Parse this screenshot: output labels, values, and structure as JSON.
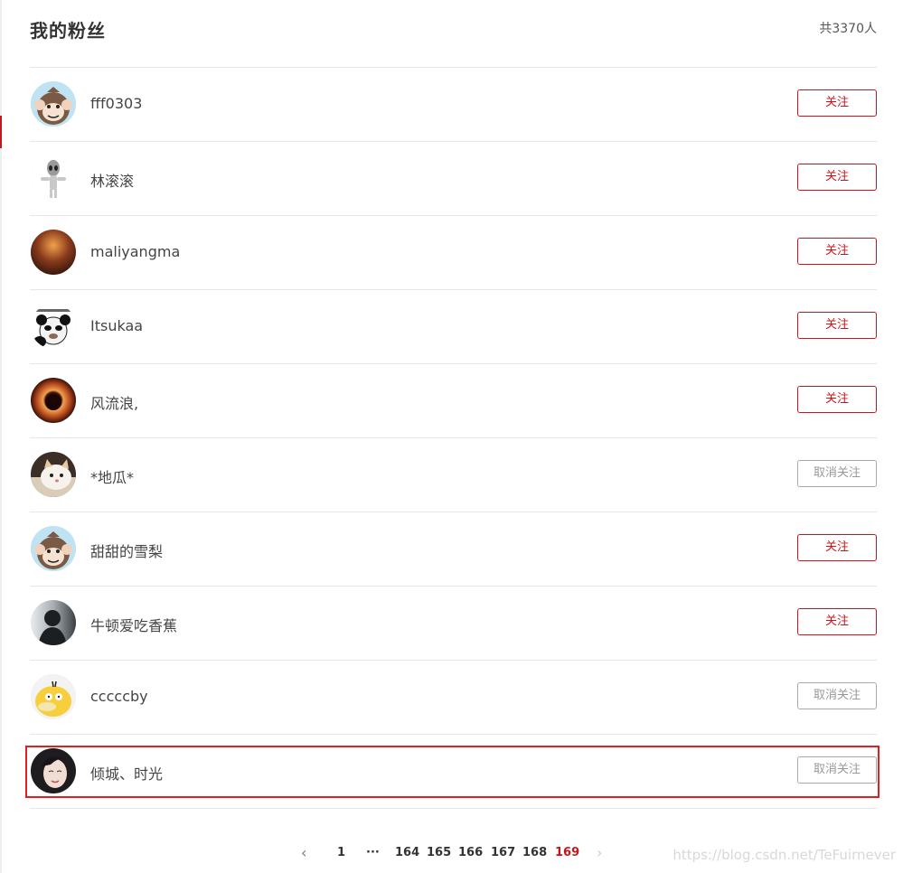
{
  "header": {
    "title": "我的粉丝",
    "total": "共3370人"
  },
  "fans": [
    {
      "name": "fff0303",
      "button": "关注",
      "state": "follow",
      "avatar": "monkey-avatar"
    },
    {
      "name": "林滚滚",
      "button": "关注",
      "state": "follow",
      "avatar": "alien-avatar"
    },
    {
      "name": "maliyangma",
      "button": "关注",
      "state": "follow",
      "avatar": "sunset-avatar"
    },
    {
      "name": "Itsukaa",
      "button": "关注",
      "state": "follow",
      "avatar": "panda-meme-avatar"
    },
    {
      "name": "风流浪,",
      "button": "关注",
      "state": "follow",
      "avatar": "tunnel-light-avatar"
    },
    {
      "name": "*地瓜*",
      "button": "取消关注",
      "state": "unfollow",
      "avatar": "cat-avatar"
    },
    {
      "name": "甜甜的雪梨",
      "button": "关注",
      "state": "follow",
      "avatar": "monkey-avatar"
    },
    {
      "name": "牛顿爱吃香蕉",
      "button": "关注",
      "state": "follow",
      "avatar": "silhouette-avatar"
    },
    {
      "name": "cccccby",
      "button": "取消关注",
      "state": "unfollow",
      "avatar": "psyduck-avatar"
    },
    {
      "name": "倾城、时光",
      "button": "取消关注",
      "state": "unfollow",
      "avatar": "girl-portrait-avatar"
    }
  ],
  "pagination": {
    "prev_icon": "chevron-left-icon",
    "next_icon": "chevron-right-icon",
    "first": "1",
    "ellipsis": "···",
    "pages": [
      "164",
      "165",
      "166",
      "167",
      "168",
      "169"
    ],
    "current": "169"
  },
  "watermark": "https://blog.csdn.net/TeFuirnever",
  "colors": {
    "accent": "#c4161c",
    "highlight_box": "#e02020",
    "divider": "#e6e6e6",
    "unfollow_border": "#a9a9a9"
  }
}
